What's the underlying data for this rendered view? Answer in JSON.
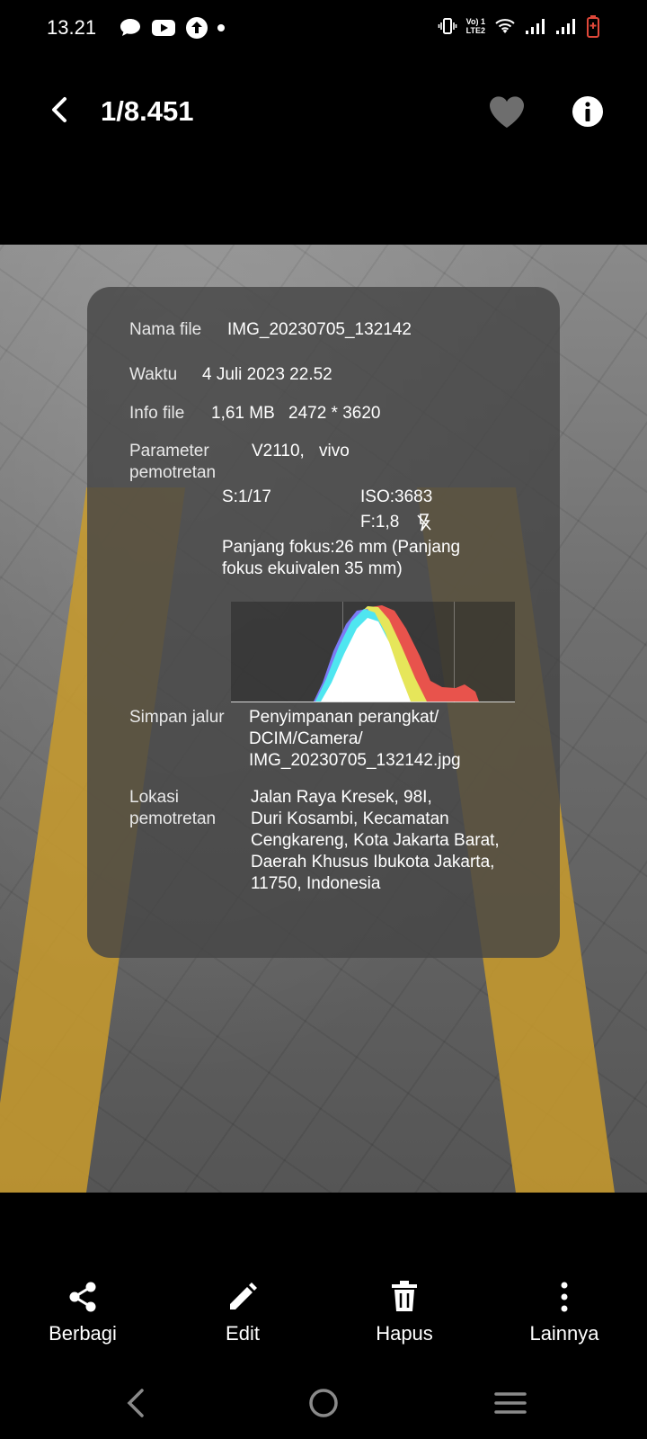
{
  "status_bar": {
    "time": "13.21",
    "lte_top": "Vo) 1",
    "lte_bottom": "LTE2",
    "left_icons": [
      "chat-bubble-icon",
      "youtube-icon",
      "upload-icon",
      "dot-icon"
    ],
    "right_icons": [
      "vibrate-icon",
      "lte-icon",
      "wifi-icon",
      "signal-icon",
      "signal-icon",
      "battery-low-icon"
    ]
  },
  "topbar": {
    "counter": "1/8.451"
  },
  "details": {
    "file_name_label": "Nama file",
    "file_name": "IMG_20230705_132142",
    "time_label": "Waktu",
    "time_value": "4 Juli 2023 22.52",
    "file_info_label": "Info file",
    "file_size": "1,61 MB",
    "resolution": "2472 * 3620",
    "params_label_1": "Parameter",
    "params_label_2": "pemotretan",
    "device_model": "V2110,",
    "device_brand": "vivo",
    "shutter": "S:1/17",
    "iso": "ISO:3683",
    "aperture": "F:1,8",
    "focal_line_1": "Panjang fokus:26 mm (Panjang",
    "focal_line_2": "fokus ekuivalen 35 mm)",
    "path_label": "Simpan jalur",
    "path_line_1": "Penyimpanan perangkat/",
    "path_line_2": "DCIM/Camera/",
    "path_line_3": "IMG_20230705_132142.jpg",
    "location_label_1": "Lokasi",
    "location_label_2": "pemotretan",
    "location_line_1": "Jalan Raya Kresek, 98I,",
    "location_line_2": "Duri Kosambi, Kecamatan",
    "location_line_3": "Cengkareng, Kota Jakarta Barat,",
    "location_line_4": "Daerah Khusus Ibukota Jakarta,",
    "location_line_5": "11750, Indonesia"
  },
  "actions": [
    {
      "label": "Berbagi",
      "icon": "share-icon"
    },
    {
      "label": "Edit",
      "icon": "pencil-icon"
    },
    {
      "label": "Hapus",
      "icon": "trash-icon"
    },
    {
      "label": "Lainnya",
      "icon": "more-vertical-icon"
    }
  ],
  "colors": {
    "background": "#000000",
    "panel": "#464646",
    "lane_yellow": "#c99b2c",
    "histogram_red": "#e8534c",
    "histogram_yellow": "#e6e65a",
    "histogram_cyan": "#4fe6f0",
    "histogram_blue": "#7b7bf5",
    "battery_red": "#e0483a"
  }
}
